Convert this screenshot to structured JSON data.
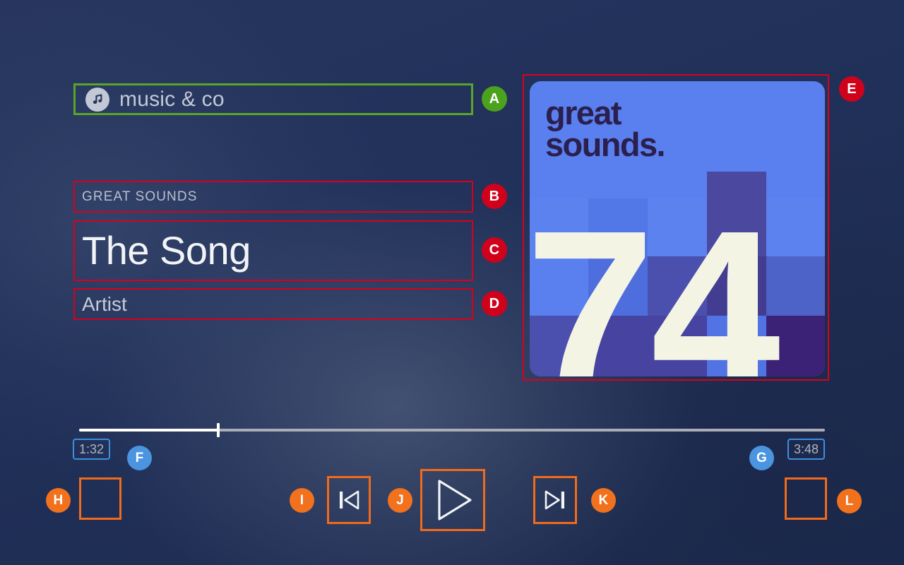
{
  "app": {
    "name": "music & co",
    "icon": "music-note-icon"
  },
  "now_playing": {
    "album_label": "GREAT SOUNDS",
    "track_title": "The Song",
    "artist": "Artist"
  },
  "album_art": {
    "wordmark_line1": "great",
    "wordmark_line2": "sounds.",
    "number": "74",
    "base_color": "#5a7fef",
    "text_color": "#2b1f4d",
    "number_color": "#f4f4e4"
  },
  "progress": {
    "elapsed": "1:32",
    "total": "3:48",
    "percent": 18.7
  },
  "controls": {
    "shuffle_label": "",
    "previous_label": "",
    "play_label": "",
    "next_label": "",
    "repeat_label": ""
  },
  "annotations": [
    {
      "id": "A",
      "target": "app-name-field",
      "color": "#4ca11e",
      "box_color": "#5aa528"
    },
    {
      "id": "B",
      "target": "album-label-field",
      "color": "#d0021b",
      "box_color": "#d8001d"
    },
    {
      "id": "C",
      "target": "track-title-field",
      "color": "#d0021b",
      "box_color": "#d8001d"
    },
    {
      "id": "D",
      "target": "artist-field",
      "color": "#d0021b",
      "box_color": "#d8001d"
    },
    {
      "id": "E",
      "target": "album-art",
      "color": "#d0021b",
      "box_color": "#d8001d"
    },
    {
      "id": "F",
      "target": "time-elapsed-chip",
      "color": "#4a94e0",
      "box_color": "#3e8fde"
    },
    {
      "id": "G",
      "target": "time-total-chip",
      "color": "#4a94e0",
      "box_color": "#3e8fde"
    },
    {
      "id": "H",
      "target": "btn-shuffle",
      "color": "#f2711c",
      "box_color": "#f26a1b"
    },
    {
      "id": "I",
      "target": "btn-prev",
      "color": "#f2711c",
      "box_color": "#f26a1b"
    },
    {
      "id": "J",
      "target": "btn-play",
      "color": "#f2711c",
      "box_color": "#f26a1b"
    },
    {
      "id": "K",
      "target": "btn-next",
      "color": "#f2711c",
      "box_color": "#f26a1b"
    },
    {
      "id": "L",
      "target": "btn-repeat",
      "color": "#f2711c",
      "box_color": "#f26a1b"
    }
  ],
  "badge_letters": {
    "a": "A",
    "b": "B",
    "c": "C",
    "d": "D",
    "e": "E",
    "f": "F",
    "g": "G",
    "h": "H",
    "i": "I",
    "j": "J",
    "k": "K",
    "l": "L"
  }
}
